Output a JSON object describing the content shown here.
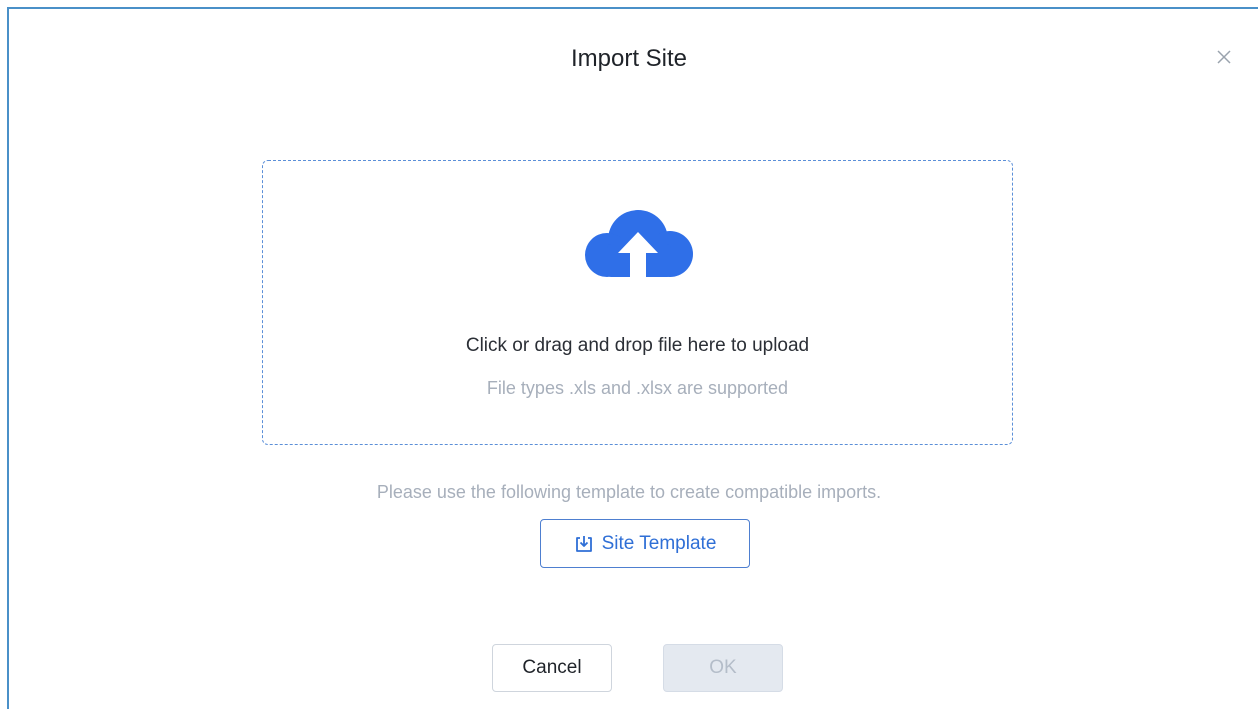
{
  "dialog": {
    "title": "Import Site",
    "close_icon": "close-icon"
  },
  "dropzone": {
    "icon": "cloud-upload-icon",
    "icon_color": "#2f6fe8",
    "title": "Click or drag and drop file here to upload",
    "subtitle": "File types .xls and .xlsx are supported"
  },
  "template": {
    "hint": "Please use the following template to create compatible imports.",
    "button_icon": "download-icon",
    "button_label": "Site Template"
  },
  "footer": {
    "cancel_label": "Cancel",
    "ok_label": "OK",
    "ok_disabled": true
  },
  "colors": {
    "accent": "#2f6fd6",
    "border_accent": "#4a90c8",
    "muted_text": "#a7afbb"
  }
}
